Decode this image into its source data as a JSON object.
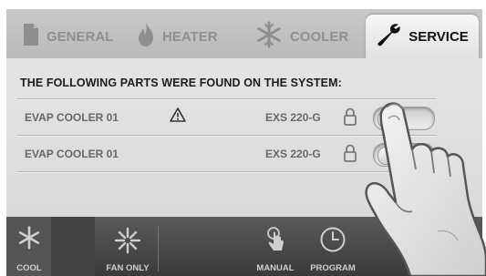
{
  "tabs": {
    "general": "GENERAL",
    "heater": "HEATER",
    "cooler": "COOLER",
    "service": "SERVICE"
  },
  "icons": {
    "general": "document-icon",
    "heater": "flame-icon",
    "cooler": "snowflake-icon",
    "service": "wrench-icon"
  },
  "heading": "THE FOLLOWING PARTS WERE FOUND ON THE SYSTEM:",
  "parts": [
    {
      "name": "EVAP COOLER 01",
      "warning": true,
      "model": "EXS 220-G",
      "locked": true
    },
    {
      "name": "EVAP COOLER 01",
      "warning": false,
      "model": "EXS 220-G",
      "locked": true
    }
  ],
  "bottom_bar": {
    "cool": "COOL",
    "fan_only": "FAN ONLY",
    "manual": "MANUAL",
    "program": "PROGRAM"
  },
  "colors": {
    "active_tab": "#f0f0f0",
    "tab_bar": "#c2c2c2",
    "content_bg": "#dedede",
    "bottom_bar": "#474747"
  }
}
